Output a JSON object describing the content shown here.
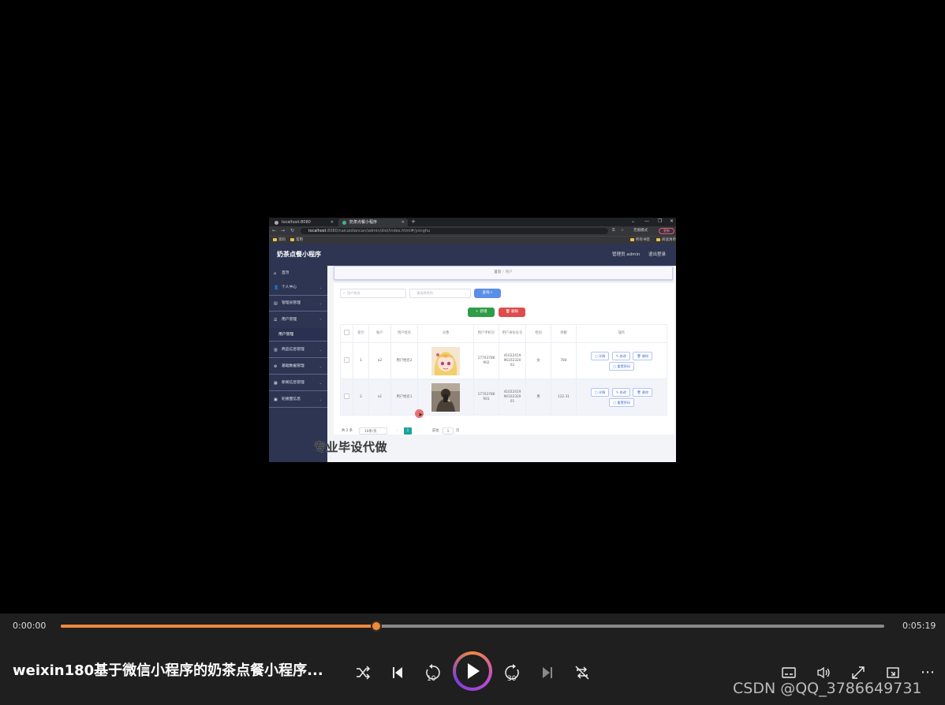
{
  "browser": {
    "tabs": [
      {
        "label": "localhost:8080"
      },
      {
        "label": "奶茶点餐小程序"
      }
    ],
    "new_tab": "+",
    "window_controls": [
      "⌄",
      "—",
      "❐",
      "✕"
    ],
    "url_host": "localhost",
    "url_rest": ":8080/naicaidiancan/admin/dist/index.html#/yonghu",
    "ext_label": "无痕模式",
    "update_label": "更新",
    "bookmarks": [
      "资料",
      "常用"
    ],
    "bookmarks_right": [
      "所有书签",
      "阅读清单"
    ]
  },
  "app": {
    "title": "奶茶点餐小程序",
    "user_label": "管理员 admin",
    "logout_label": "退出登录"
  },
  "sidebar": {
    "items": [
      {
        "label": "首页",
        "icon": "⌂"
      },
      {
        "label": "个人中心",
        "icon": "👤"
      },
      {
        "label": "管理员管理",
        "icon": "▤"
      },
      {
        "label": "用户管理",
        "icon": "☰"
      },
      {
        "label": "商品信息管理",
        "icon": "▥"
      },
      {
        "label": "基础数据管理",
        "icon": "⚙"
      },
      {
        "label": "新闻信息管理",
        "icon": "▦"
      },
      {
        "label": "轮播图信息",
        "icon": "▣"
      }
    ],
    "sub_item": "用户管理"
  },
  "breadcrumb": {
    "home": "首页",
    "sep": "/",
    "current": "用户"
  },
  "search": {
    "name_placeholder": "用户姓名",
    "gender_placeholder": "请选择性别",
    "search_button": "查询",
    "add_button": "新增",
    "delete_button": "删除"
  },
  "table": {
    "headers": [
      "索引",
      "账户",
      "用户姓名",
      "头像",
      "用户手机号",
      "用户身份证号",
      "性别",
      "余额",
      "操作"
    ],
    "rows": [
      {
        "index": "1",
        "account": "a2",
        "name": "用户姓名2",
        "phone_1": "17703786",
        "phone_2": "902",
        "id_1": "41022419",
        "id_2": "96102320",
        "id_3": "02",
        "gender": "女",
        "balance": "784"
      },
      {
        "index": "2",
        "account": "a1",
        "name": "用户姓名1",
        "phone_1": "17703786",
        "phone_2": "901",
        "id_1": "41022419",
        "id_2": "96102320",
        "id_3": "01",
        "gender": "男",
        "balance": "122.31"
      }
    ],
    "actions": {
      "detail": "详情",
      "edit": "修改",
      "delete": "删除",
      "reset": "重置密码"
    }
  },
  "pager": {
    "total": "共 2 条",
    "page_size": "10条/页",
    "current_page": "1",
    "goto_label": "前往",
    "goto_value": "1",
    "page_unit": "页"
  },
  "overlay_caption": "专业毕设代做",
  "player": {
    "current_time": "0:00:00",
    "duration": "0:05:19",
    "progress": 0.383,
    "title": "weixin180基于微信小程序的奶茶点餐小程序...",
    "rewind_label": "10",
    "forward_label": "30",
    "accent": "#f08a3c"
  },
  "watermark": "CSDN @QQ_3786649731"
}
